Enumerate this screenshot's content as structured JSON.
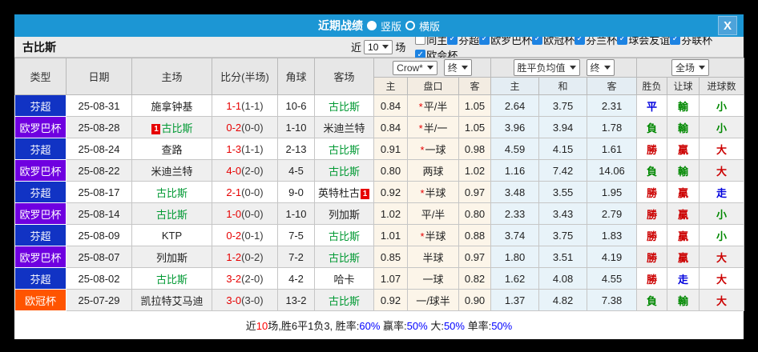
{
  "titlebar": {
    "title": "近期战绩",
    "vertical_label": "竖版",
    "vertical_selected": true,
    "horizontal_label": "横版",
    "horizontal_selected": false,
    "close_icon": "X",
    "bar_color": "#1c96d4"
  },
  "filterbar": {
    "team": "古比斯",
    "recent_label": "近",
    "recent_value": "10",
    "recent_suffix": "场",
    "same_home": {
      "label": "同主",
      "checked": false
    },
    "leagues": [
      {
        "label": "芬超",
        "checked": true
      },
      {
        "label": "欧罗巴杯",
        "checked": true
      },
      {
        "label": "欧冠杯",
        "checked": true
      },
      {
        "label": "芬兰杯",
        "checked": true
      },
      {
        "label": "球会友谊",
        "checked": true
      },
      {
        "label": "芬联杯",
        "checked": true
      },
      {
        "label": "欧会杯",
        "checked": true
      }
    ]
  },
  "table": {
    "headers": {
      "type": "类型",
      "date": "日期",
      "home": "主场",
      "score": "比分(半场)",
      "corner": "角球",
      "away": "客场",
      "odds_source": "Crow*",
      "odds_time": "终",
      "avg_source": "胜平负均值",
      "avg_time": "终",
      "result_scope": "全场",
      "sub": [
        "主",
        "盘口",
        "客",
        "主",
        "和",
        "客",
        "胜负",
        "让球",
        "进球数"
      ]
    },
    "league_palette": {
      "blue": "#1133c4",
      "purple": "#6f00e0",
      "orange": "#ff5400"
    },
    "result_palette": {
      "red": "#cc0000",
      "green": "#008800",
      "blue": "#0000dd"
    },
    "rows": [
      {
        "league": "芬超",
        "league_color": "blue",
        "date": "25-08-31",
        "home": {
          "name": "施拿钟基",
          "is_self": false,
          "red_card": null
        },
        "score_ft": "1-1",
        "score_ht": "(1-1)",
        "corners": "10-6",
        "away": {
          "name": "古比斯",
          "is_self": true,
          "red_card": null
        },
        "odds": {
          "home": "0.84",
          "handicap": "平/半",
          "handicap_star": true,
          "away": "1.05"
        },
        "avg": {
          "win": "2.64",
          "draw": "3.75",
          "lose": "2.31"
        },
        "results": [
          {
            "text": "平",
            "color": "blue"
          },
          {
            "text": "輸",
            "color": "green"
          },
          {
            "text": "小",
            "color": "green"
          }
        ]
      },
      {
        "league": "欧罗巴杯",
        "league_color": "purple",
        "date": "25-08-28",
        "home": {
          "name": "古比斯",
          "is_self": true,
          "red_card": "before"
        },
        "score_ft": "0-2",
        "score_ht": "(0-0)",
        "corners": "1-10",
        "away": {
          "name": "米迪兰特",
          "is_self": false,
          "red_card": null
        },
        "odds": {
          "home": "0.84",
          "handicap": "半/一",
          "handicap_star": true,
          "away": "1.05"
        },
        "avg": {
          "win": "3.96",
          "draw": "3.94",
          "lose": "1.78"
        },
        "results": [
          {
            "text": "負",
            "color": "green"
          },
          {
            "text": "輸",
            "color": "green"
          },
          {
            "text": "小",
            "color": "green"
          }
        ]
      },
      {
        "league": "芬超",
        "league_color": "blue",
        "date": "25-08-24",
        "home": {
          "name": "查路",
          "is_self": false,
          "red_card": null
        },
        "score_ft": "1-3",
        "score_ht": "(1-1)",
        "corners": "2-13",
        "away": {
          "name": "古比斯",
          "is_self": true,
          "red_card": null
        },
        "odds": {
          "home": "0.91",
          "handicap": "一球",
          "handicap_star": true,
          "away": "0.98"
        },
        "avg": {
          "win": "4.59",
          "draw": "4.15",
          "lose": "1.61"
        },
        "results": [
          {
            "text": "勝",
            "color": "red"
          },
          {
            "text": "贏",
            "color": "red"
          },
          {
            "text": "大",
            "color": "red"
          }
        ]
      },
      {
        "league": "欧罗巴杯",
        "league_color": "purple",
        "date": "25-08-22",
        "home": {
          "name": "米迪兰特",
          "is_self": false,
          "red_card": null
        },
        "score_ft": "4-0",
        "score_ht": "(2-0)",
        "corners": "4-5",
        "away": {
          "name": "古比斯",
          "is_self": true,
          "red_card": null
        },
        "odds": {
          "home": "0.80",
          "handicap": "两球",
          "handicap_star": false,
          "away": "1.02"
        },
        "avg": {
          "win": "1.16",
          "draw": "7.42",
          "lose": "14.06"
        },
        "results": [
          {
            "text": "負",
            "color": "green"
          },
          {
            "text": "輸",
            "color": "green"
          },
          {
            "text": "大",
            "color": "red"
          }
        ]
      },
      {
        "league": "芬超",
        "league_color": "blue",
        "date": "25-08-17",
        "home": {
          "name": "古比斯",
          "is_self": true,
          "red_card": null
        },
        "score_ft": "2-1",
        "score_ht": "(0-0)",
        "corners": "9-0",
        "away": {
          "name": "英特杜古",
          "is_self": false,
          "red_card": "after"
        },
        "odds": {
          "home": "0.92",
          "handicap": "半球",
          "handicap_star": true,
          "away": "0.97"
        },
        "avg": {
          "win": "3.48",
          "draw": "3.55",
          "lose": "1.95"
        },
        "results": [
          {
            "text": "勝",
            "color": "red"
          },
          {
            "text": "贏",
            "color": "red"
          },
          {
            "text": "走",
            "color": "blue"
          }
        ]
      },
      {
        "league": "欧罗巴杯",
        "league_color": "purple",
        "date": "25-08-14",
        "home": {
          "name": "古比斯",
          "is_self": true,
          "red_card": null
        },
        "score_ft": "1-0",
        "score_ht": "(0-0)",
        "corners": "1-10",
        "away": {
          "name": "列加斯",
          "is_self": false,
          "red_card": null
        },
        "odds": {
          "home": "1.02",
          "handicap": "平/半",
          "handicap_star": false,
          "away": "0.80"
        },
        "avg": {
          "win": "2.33",
          "draw": "3.43",
          "lose": "2.79"
        },
        "results": [
          {
            "text": "勝",
            "color": "red"
          },
          {
            "text": "贏",
            "color": "red"
          },
          {
            "text": "小",
            "color": "green"
          }
        ]
      },
      {
        "league": "芬超",
        "league_color": "blue",
        "date": "25-08-09",
        "home": {
          "name": "KTP",
          "is_self": false,
          "red_card": null
        },
        "score_ft": "0-2",
        "score_ht": "(0-1)",
        "corners": "7-5",
        "away": {
          "name": "古比斯",
          "is_self": true,
          "red_card": null
        },
        "odds": {
          "home": "1.01",
          "handicap": "半球",
          "handicap_star": true,
          "away": "0.88"
        },
        "avg": {
          "win": "3.74",
          "draw": "3.75",
          "lose": "1.83"
        },
        "results": [
          {
            "text": "勝",
            "color": "red"
          },
          {
            "text": "贏",
            "color": "red"
          },
          {
            "text": "小",
            "color": "green"
          }
        ]
      },
      {
        "league": "欧罗巴杯",
        "league_color": "purple",
        "date": "25-08-07",
        "home": {
          "name": "列加斯",
          "is_self": false,
          "red_card": null
        },
        "score_ft": "1-2",
        "score_ht": "(0-2)",
        "corners": "7-2",
        "away": {
          "name": "古比斯",
          "is_self": true,
          "red_card": null
        },
        "odds": {
          "home": "0.85",
          "handicap": "半球",
          "handicap_star": false,
          "away": "0.97"
        },
        "avg": {
          "win": "1.80",
          "draw": "3.51",
          "lose": "4.19"
        },
        "results": [
          {
            "text": "勝",
            "color": "red"
          },
          {
            "text": "贏",
            "color": "red"
          },
          {
            "text": "大",
            "color": "red"
          }
        ]
      },
      {
        "league": "芬超",
        "league_color": "blue",
        "date": "25-08-02",
        "home": {
          "name": "古比斯",
          "is_self": true,
          "red_card": null
        },
        "score_ft": "3-2",
        "score_ht": "(2-0)",
        "corners": "4-2",
        "away": {
          "name": "哈卡",
          "is_self": false,
          "red_card": null
        },
        "odds": {
          "home": "1.07",
          "handicap": "一球",
          "handicap_star": false,
          "away": "0.82"
        },
        "avg": {
          "win": "1.62",
          "draw": "4.08",
          "lose": "4.55"
        },
        "results": [
          {
            "text": "勝",
            "color": "red"
          },
          {
            "text": "走",
            "color": "blue"
          },
          {
            "text": "大",
            "color": "red"
          }
        ]
      },
      {
        "league": "欧冠杯",
        "league_color": "orange",
        "date": "25-07-29",
        "home": {
          "name": "凯拉特艾马迪",
          "is_self": false,
          "red_card": null
        },
        "score_ft": "3-0",
        "score_ht": "(3-0)",
        "corners": "13-2",
        "away": {
          "name": "古比斯",
          "is_self": true,
          "red_card": null
        },
        "odds": {
          "home": "0.92",
          "handicap": "一/球半",
          "handicap_star": false,
          "away": "0.90"
        },
        "avg": {
          "win": "1.37",
          "draw": "4.82",
          "lose": "7.38"
        },
        "results": [
          {
            "text": "負",
            "color": "green"
          },
          {
            "text": "輸",
            "color": "green"
          },
          {
            "text": "大",
            "color": "red"
          }
        ]
      }
    ]
  },
  "footer": {
    "palette": {
      "normal": "#1a1a1a",
      "red": "#ff0000",
      "blue": "#0000ff"
    },
    "segments": [
      {
        "text": "近",
        "tone": "normal"
      },
      {
        "text": "10",
        "tone": "red"
      },
      {
        "text": "场,胜6平1负3, ",
        "tone": "normal"
      },
      {
        "text": "胜率:",
        "tone": "normal"
      },
      {
        "text": "60%",
        "tone": "blue"
      },
      {
        "text": " 赢率:",
        "tone": "normal"
      },
      {
        "text": "50%",
        "tone": "blue"
      },
      {
        "text": " 大:",
        "tone": "normal"
      },
      {
        "text": "50%",
        "tone": "blue"
      },
      {
        "text": " 单率:",
        "tone": "normal"
      },
      {
        "text": "50%",
        "tone": "blue"
      }
    ]
  }
}
